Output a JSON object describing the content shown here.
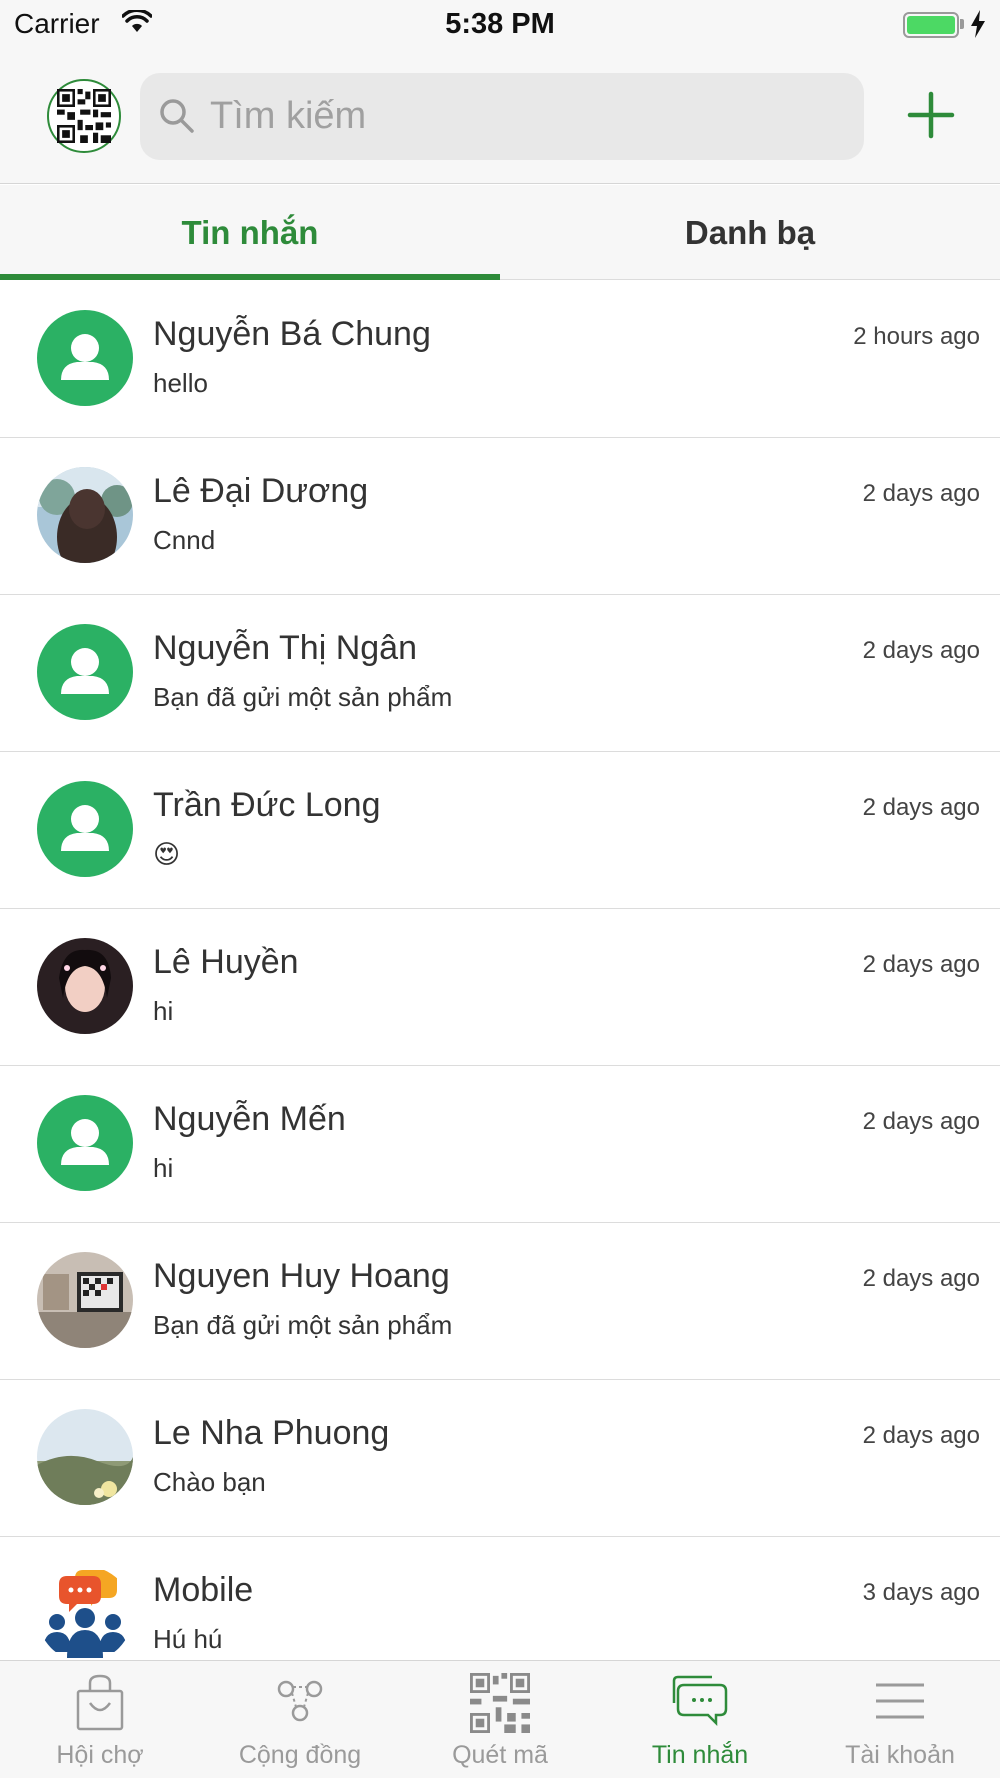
{
  "status_bar": {
    "carrier": "Carrier",
    "time": "5:38 PM"
  },
  "header": {
    "search_placeholder": "Tìm kiếm"
  },
  "tabs": [
    {
      "label": "Tin nhắn",
      "active": true
    },
    {
      "label": "Danh bạ",
      "active": false
    }
  ],
  "conversations": [
    {
      "name": "Nguyễn Bá Chung",
      "message": "hello",
      "time": "2 hours ago",
      "avatar": "default-avatar-icon"
    },
    {
      "name": "Lê Đại Dương",
      "message": "Cnnd",
      "time": "2 days ago",
      "avatar": "user-photo"
    },
    {
      "name": "Nguyễn Thị Ngân",
      "message": "Bạn đã gửi một sản phẩm",
      "time": "2 days ago",
      "avatar": "default-avatar-icon"
    },
    {
      "name": "Trần Đức Long",
      "message": "😍",
      "time": "2 days ago",
      "avatar": "default-avatar-icon"
    },
    {
      "name": "Lê Huyền",
      "message": "hi",
      "time": "2 days ago",
      "avatar": "user-photo"
    },
    {
      "name": "Nguyễn Mến",
      "message": "hi",
      "time": "2 days ago",
      "avatar": "default-avatar-icon"
    },
    {
      "name": "Nguyen Huy Hoang",
      "message": "Bạn đã gửi một sản phẩm",
      "time": "2 days ago",
      "avatar": "user-photo"
    },
    {
      "name": "Le Nha Phuong",
      "message": "Chào bạn",
      "time": "2 days ago",
      "avatar": "user-photo"
    },
    {
      "name": "Mobile",
      "message": "Hú hú",
      "time": "3 days ago",
      "avatar": "group-chat-icon"
    }
  ],
  "tabbar": [
    {
      "label": "Hội chợ",
      "icon": "shopping-bag-icon",
      "active": false
    },
    {
      "label": "Cộng đồng",
      "icon": "community-icon",
      "active": false
    },
    {
      "label": "Quét mã",
      "icon": "qr-scan-icon",
      "active": false
    },
    {
      "label": "Tin nhắn",
      "icon": "chat-icon",
      "active": true
    },
    {
      "label": "Tài khoản",
      "icon": "menu-icon",
      "active": false
    }
  ],
  "colors": {
    "accent": "#2e8b3a",
    "avatar_default": "#2bb164",
    "inactive": "#9a9a9a"
  }
}
